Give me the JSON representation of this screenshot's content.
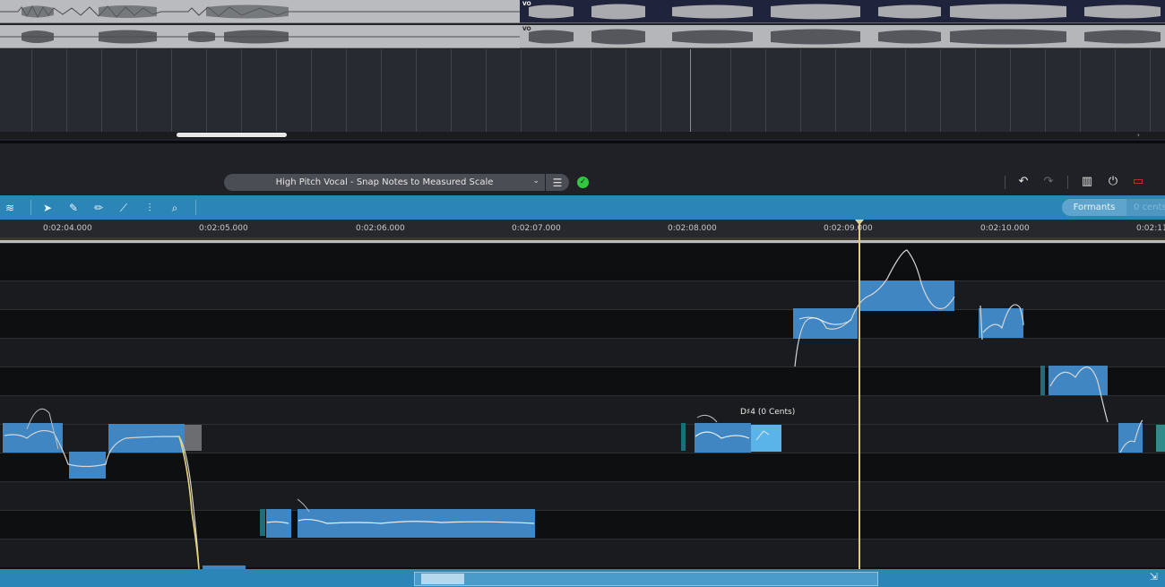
{
  "tracks": [
    {
      "clip_label": "",
      "second_clip_label": "VO"
    },
    {
      "clip_label": "",
      "second_clip_label": "VO"
    }
  ],
  "header": {
    "preset": "High Pitch Vocal - Snap Notes to Measured Scale",
    "status": "✓"
  },
  "toolbar": {
    "formants_label": "Formants",
    "cents_value": "0 cents"
  },
  "ruler": {
    "labels": [
      "0:02:04.000",
      "0:02:05.000",
      "0:02:06.000",
      "0:02:07.000",
      "0:02:08.000",
      "0:02:09.000",
      "0:02:10.000",
      "0:02:11."
    ]
  },
  "editor": {
    "tooltip": "D♯4 (0 Cents)"
  },
  "icons": {
    "undo": "undo-icon",
    "redo": "redo-icon",
    "grid": "grid-view-icon",
    "power": "power-icon",
    "record": "record-icon"
  },
  "colors": {
    "accent": "#2b85b7",
    "note_blob": "#3f86c2",
    "playhead": "#e6c77f",
    "status_ok": "#35c63f"
  }
}
